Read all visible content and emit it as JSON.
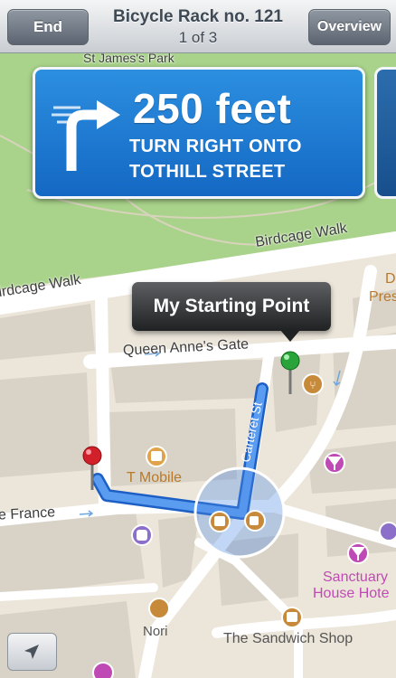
{
  "top_bar": {
    "end_label": "End",
    "title": "Bicycle Rack no. 121",
    "subtitle": "1 of 3",
    "overview_label": "Overview"
  },
  "direction": {
    "distance": "250 feet",
    "line1": "TURN RIGHT ONTO",
    "line2": "TOTHILL STREET",
    "icon": "turn-right-arrow-icon"
  },
  "callout": {
    "text": "My Starting Point"
  },
  "map_labels": {
    "park": "St James's Park",
    "birdcage_walk_1": "Birdcage Walk",
    "birdcage_walk_2": "irdcage Walk",
    "queen_annes_gate": "Queen Anne's Gate",
    "carteret_st": "Carteret St",
    "petty_france": "e France",
    "t_mobile": "T Mobile",
    "sanctuary_house_1": "Sanctuary",
    "sanctuary_house_2": "House Hote",
    "nori": "Nori",
    "sandwich_shop": "The Sandwich Shop",
    "edge_pres_1": "D",
    "edge_pres_2": "Pres"
  },
  "colors": {
    "park_green": "#a9d38a",
    "route_blue": "#3f86e8",
    "sign_blue": "#1d7ad6",
    "poi_orange": "#c78a3a",
    "poi_purple": "#c04ab5"
  }
}
